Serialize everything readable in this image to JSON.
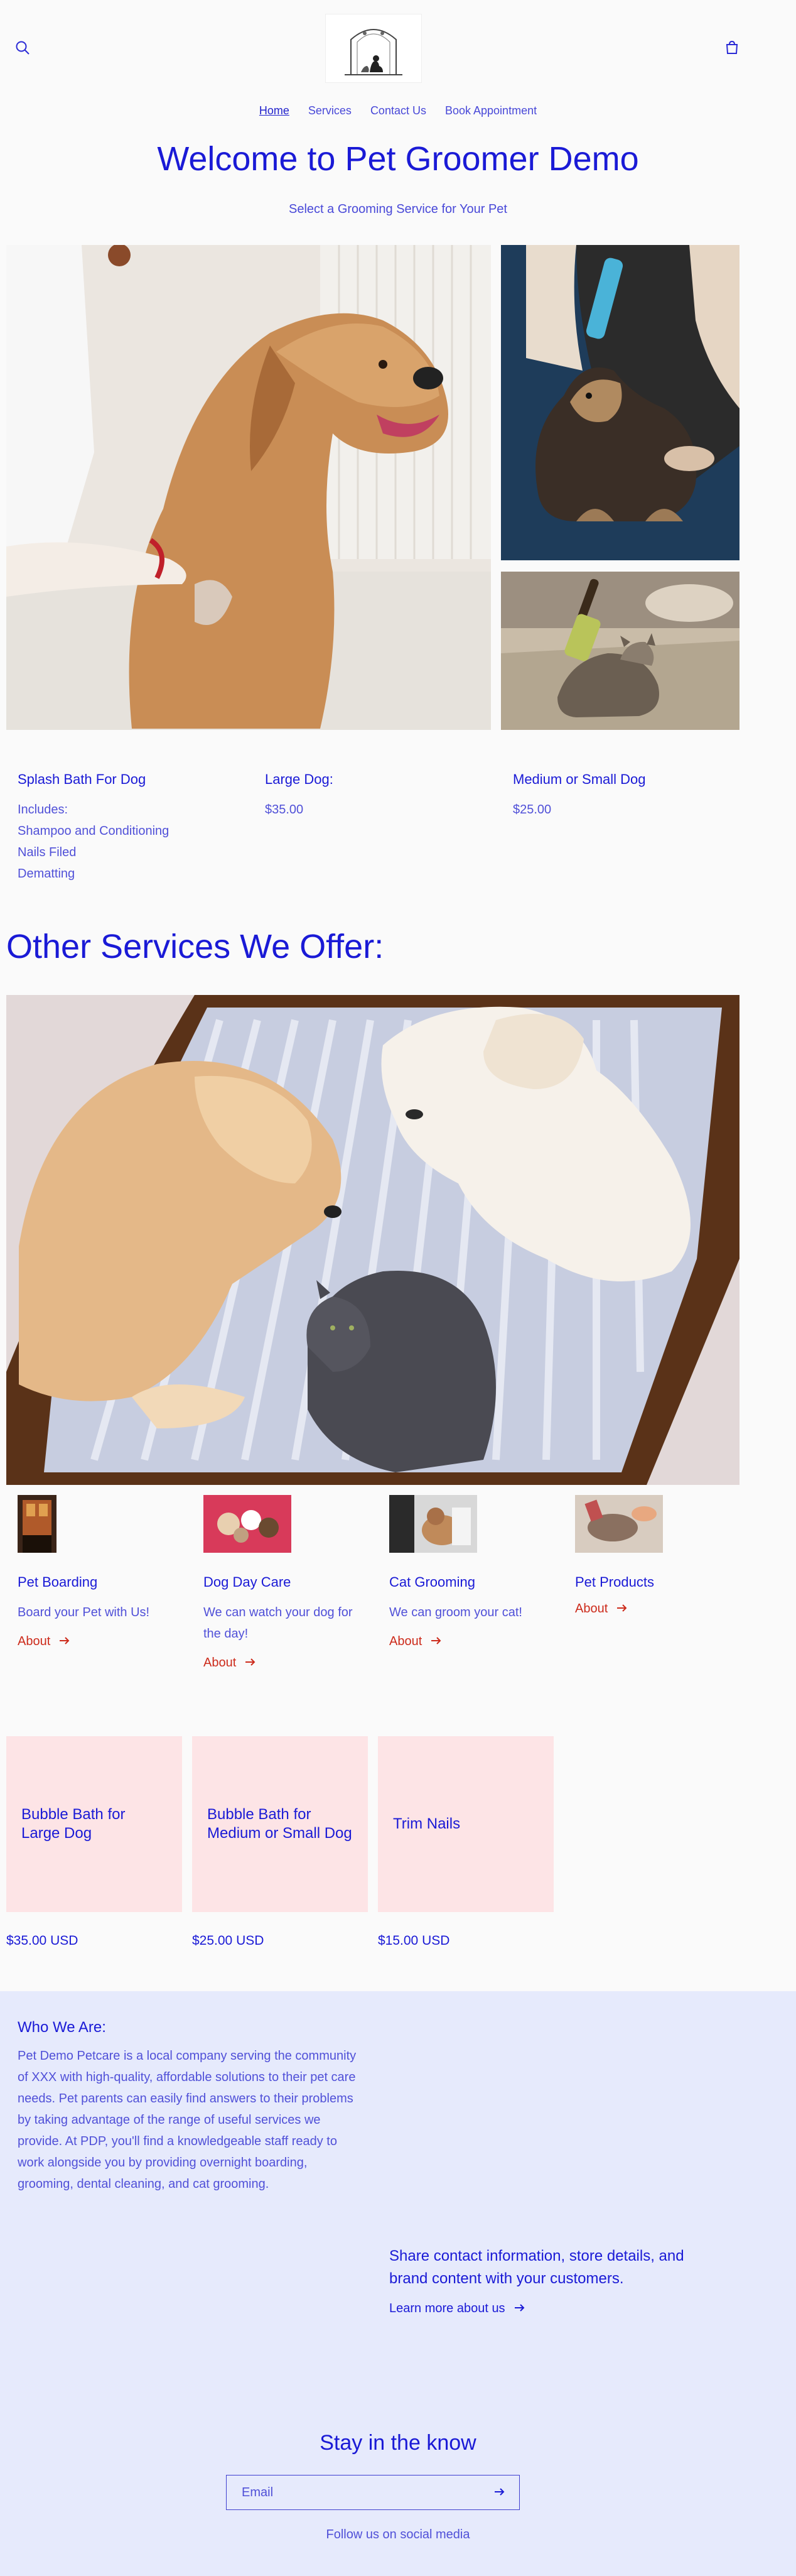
{
  "nav": {
    "items": [
      "Home",
      "Services",
      "Contact Us",
      "Book Appointment"
    ]
  },
  "hero": {
    "title": "Welcome to Pet Groomer Demo",
    "subtitle": "Select a Grooming Service for Your Pet"
  },
  "services": [
    {
      "title": "Splash Bath For Dog",
      "body": "Includes:\nShampoo and Conditioning\nNails Filed\nDematting"
    },
    {
      "title": "Large Dog:",
      "body": "$35.00"
    },
    {
      "title": "Medium or Small Dog",
      "body": "$25.00"
    }
  ],
  "other": {
    "heading": "Other Services We Offer:",
    "cards": [
      {
        "title": "Pet Boarding",
        "desc": "Board your Pet with Us!",
        "link": "About"
      },
      {
        "title": "Dog Day Care",
        "desc": "We can watch your dog for the day!",
        "link": "About"
      },
      {
        "title": "Cat Grooming",
        "desc": "We can groom your cat!",
        "link": "About"
      },
      {
        "title": "Pet Products",
        "desc": "",
        "link": "About"
      }
    ]
  },
  "products": [
    {
      "name": "Bubble Bath for Large Dog",
      "price": "$35.00 USD"
    },
    {
      "name": "Bubble Bath for Medium or Small Dog",
      "price": "$25.00 USD"
    },
    {
      "name": "Trim Nails",
      "price": "$15.00 USD"
    }
  ],
  "about": {
    "heading": "Who We Are:",
    "body": "Pet Demo Petcare is a local company serving the community of XXX with high-quality, affordable solutions to their pet care needs. Pet parents can easily find answers to their problems by taking advantage of the range of useful services we provide. At PDP, you'll find a knowledgeable staff ready to work alongside you by providing overnight boarding, grooming, dental cleaning, and cat grooming.",
    "share": "Share contact information, store details, and brand content with your customers.",
    "learn_more": "Learn more about us"
  },
  "newsletter": {
    "heading": "Stay in the know",
    "placeholder": "Email",
    "follow": "Follow us on social media"
  },
  "icons": {
    "search": "search-icon",
    "cart": "cart-icon",
    "arrow": "arrow-right-icon"
  },
  "colors": {
    "accent": "#1a1ad6",
    "link_red": "#cc2a1a",
    "product_tile": "#fde4e6",
    "about_band": "#e6eafc"
  }
}
